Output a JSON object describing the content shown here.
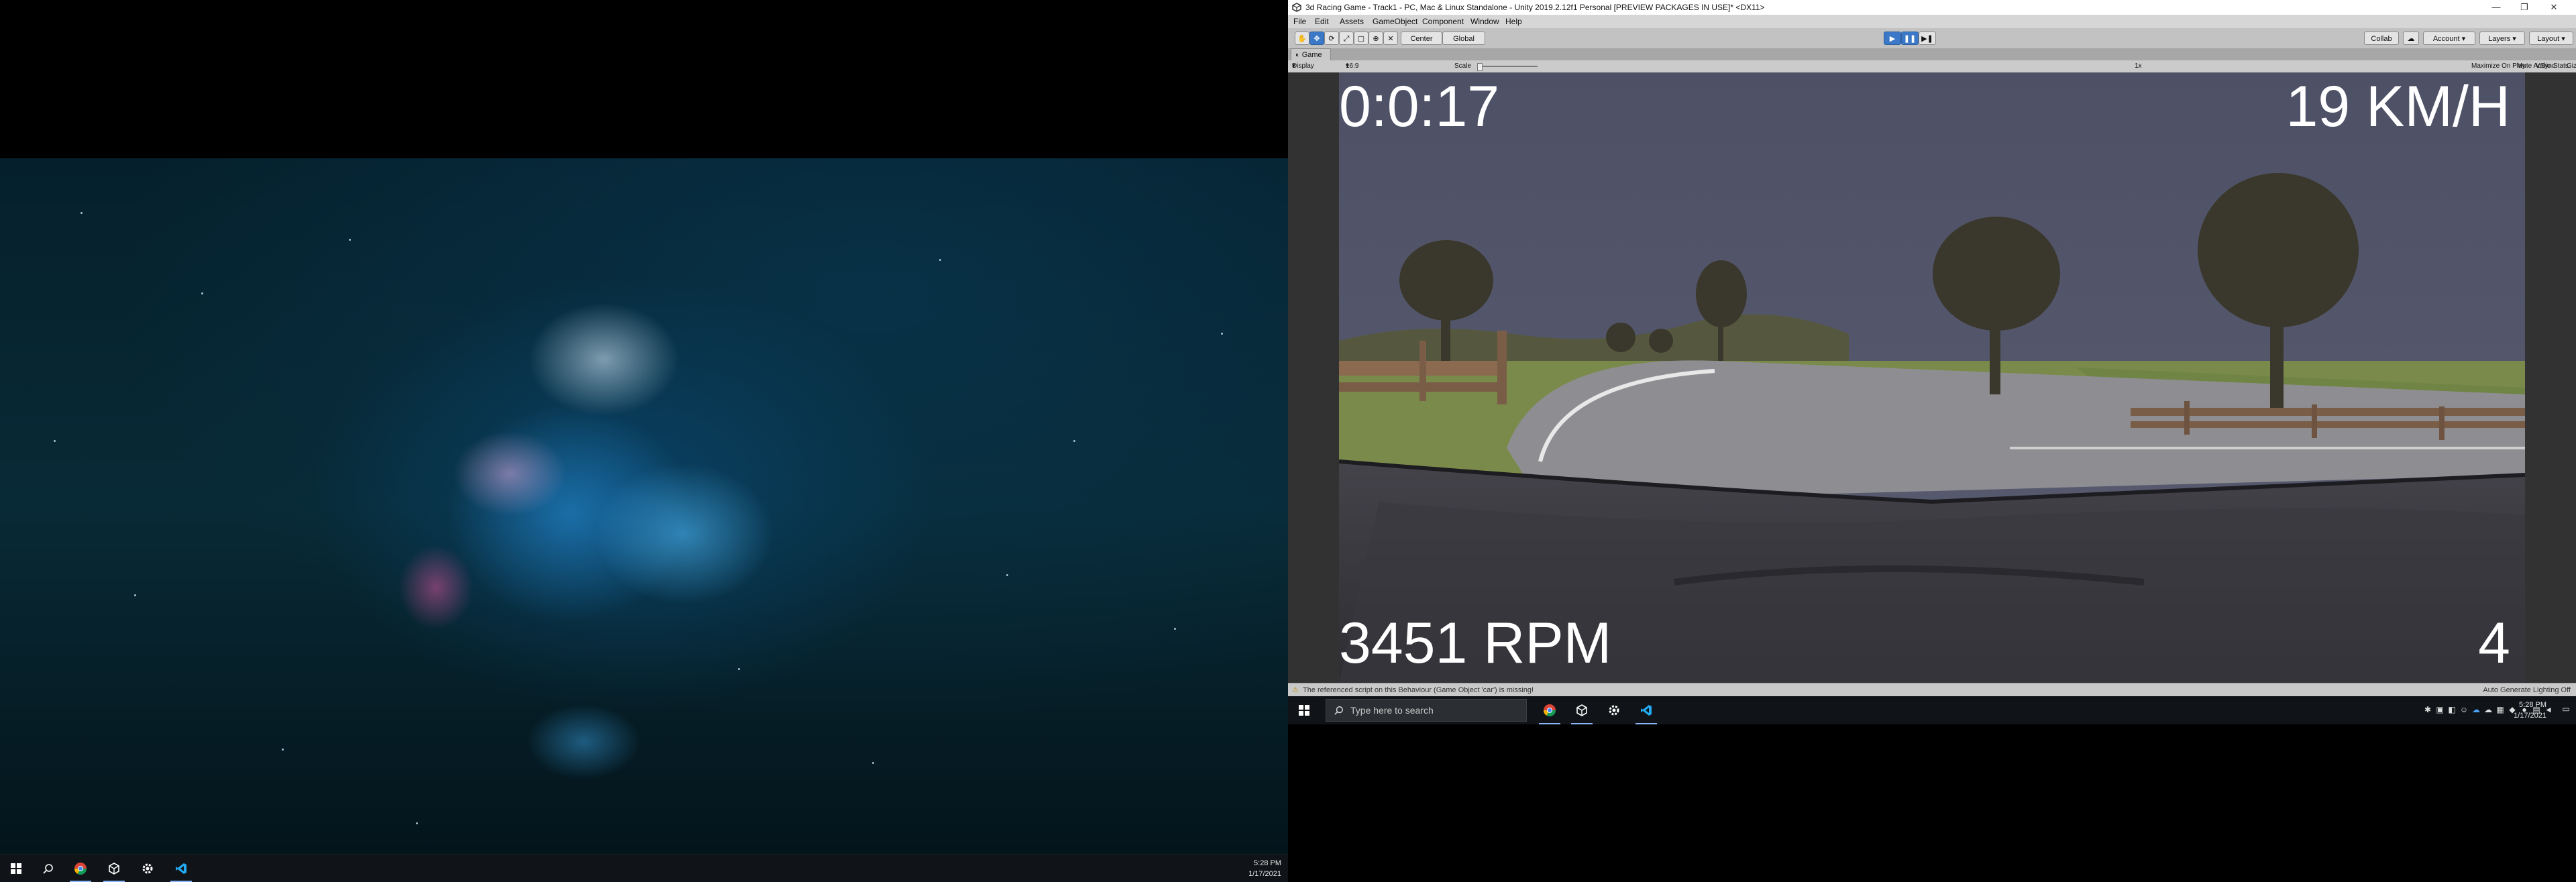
{
  "left_screen": {
    "taskbar": {
      "clock_time": "5:28 PM",
      "clock_date": "1/17/2021",
      "icons": [
        "windows-start-icon",
        "search-icon",
        "chrome-icon",
        "unity-hub-icon",
        "settings-gear-icon",
        "vscode-icon"
      ]
    }
  },
  "unity": {
    "window_title": "3d Racing Game - Track1 - PC, Mac & Linux Standalone - Unity 2019.2.12f1 Personal [PREVIEW PACKAGES IN USE]* <DX11>",
    "menu": [
      "File",
      "Edit",
      "Assets",
      "GameObject",
      "Component",
      "Window",
      "Help"
    ],
    "toolbar": {
      "pivot_label": "Center",
      "space_label": "Global",
      "collab_label": "Collab",
      "account_label": "Account",
      "layers_label": "Layers",
      "layout_label": "Layout"
    },
    "game_tab_label": "Game",
    "game_controls": {
      "display": "Display 1",
      "aspect": "16:9",
      "scale_label": "Scale",
      "scale_value": "1x",
      "maximize_on_play": "Maximize On Play",
      "mute_audio": "Mute Audio",
      "vsync": "VSync",
      "stats": "Stats",
      "gizmos": "Gizmos"
    },
    "hud": {
      "time": "0:0:17",
      "speed": "19 KM/H",
      "rpm": "3451 RPM",
      "gear": "4"
    },
    "status": {
      "warning": "The referenced script on this Behaviour (Game Object 'car') is missing!",
      "lighting": "Auto Generate Lighting Off"
    }
  },
  "right_screen": {
    "taskbar": {
      "search_placeholder": "Type here to search",
      "clock_time": "5:28 PM",
      "clock_date": "1/17/2021"
    }
  },
  "colors": {
    "accent_blue": "#3b78c8",
    "sky": "#53566a",
    "grass": "#7a8a4a",
    "road": "#8e8e92",
    "car_hood": "#3b3a3f"
  }
}
